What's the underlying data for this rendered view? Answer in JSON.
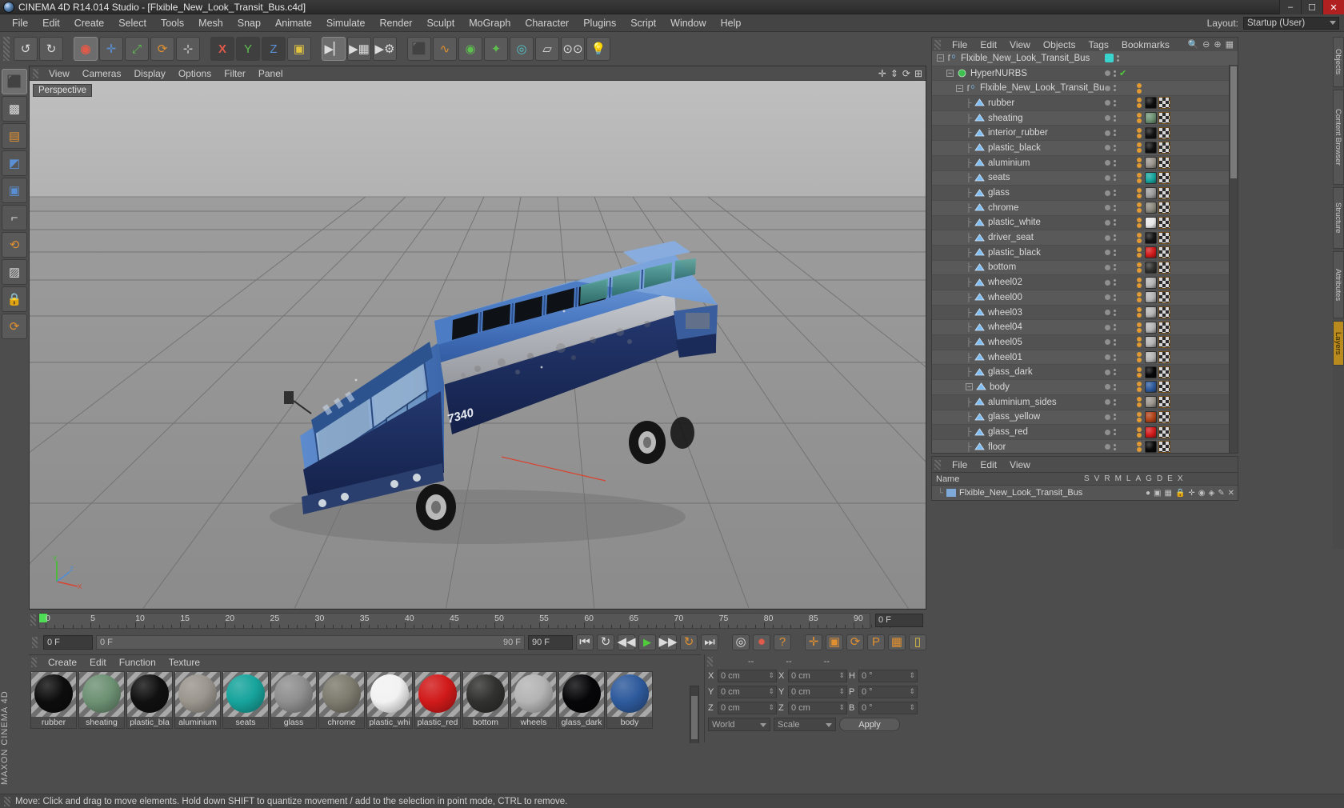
{
  "window": {
    "title": "CINEMA 4D R14.014 Studio - [Flxible_New_Look_Transit_Bus.c4d]",
    "minimize": "–",
    "maximize": "☐",
    "close": "✕"
  },
  "menubar": {
    "items": [
      "File",
      "Edit",
      "Create",
      "Select",
      "Tools",
      "Mesh",
      "Snap",
      "Animate",
      "Simulate",
      "Render",
      "Sculpt",
      "MoGraph",
      "Character",
      "Plugins",
      "Script",
      "Window",
      "Help"
    ],
    "layout_label": "Layout:",
    "layout_value": "Startup (User)"
  },
  "viewport": {
    "menu": [
      "View",
      "Cameras",
      "Display",
      "Options",
      "Filter",
      "Panel"
    ],
    "label": "Perspective",
    "axis": {
      "x": "X",
      "y": "Y",
      "z": "Z"
    }
  },
  "timeline": {
    "ticks": [
      "0",
      "5",
      "10",
      "15",
      "20",
      "25",
      "30",
      "35",
      "40",
      "45",
      "50",
      "55",
      "60",
      "65",
      "70",
      "75",
      "80",
      "85",
      "90"
    ],
    "current_frame": "0 F"
  },
  "playback": {
    "frame_field": "0 F",
    "range_start": "0 F",
    "range_end_left": "90 F",
    "range_end_right": "90 F"
  },
  "material_manager": {
    "menu": [
      "Create",
      "Edit",
      "Function",
      "Texture"
    ],
    "materials": [
      {
        "name": "rubber",
        "color": "#0d0d0d"
      },
      {
        "name": "sheating",
        "color": "#6d9173"
      },
      {
        "name": "plastic_bla",
        "color": "#101010"
      },
      {
        "name": "aluminium",
        "color": "#9a958d"
      },
      {
        "name": "seats",
        "color": "#17a49c"
      },
      {
        "name": "glass",
        "color": "#8f8f8f"
      },
      {
        "name": "chrome",
        "color": "#7d7a6e"
      },
      {
        "name": "plastic_whi",
        "color": "#f2f2f2"
      },
      {
        "name": "plastic_red",
        "color": "#d11a1a"
      },
      {
        "name": "bottom",
        "color": "#31312f"
      },
      {
        "name": "wheels",
        "color": "#b4b4b4"
      },
      {
        "name": "glass_dark",
        "color": "#060608"
      },
      {
        "name": "body",
        "color": "#2e5a9c"
      }
    ]
  },
  "coordinates": {
    "headers": [
      "--",
      "--",
      "--"
    ],
    "rows": [
      {
        "l1": "X",
        "v1": "0 cm",
        "l2": "X",
        "v2": "0 cm",
        "l3": "H",
        "v3": "0 °"
      },
      {
        "l1": "Y",
        "v1": "0 cm",
        "l2": "Y",
        "v2": "0 cm",
        "l3": "P",
        "v3": "0 °"
      },
      {
        "l1": "Z",
        "v1": "0 cm",
        "l2": "Z",
        "v2": "0 cm",
        "l3": "B",
        "v3": "0 °"
      }
    ],
    "world_select": "World",
    "scale_select": "Scale",
    "apply_button": "Apply"
  },
  "object_manager": {
    "menu": [
      "File",
      "Edit",
      "View",
      "Objects",
      "Tags",
      "Bookmarks"
    ],
    "items": [
      {
        "name": "Flxible_New_Look_Transit_Bus",
        "indent": 0,
        "icon": "null-object",
        "expander": true,
        "teal": true,
        "check": false,
        "tags": []
      },
      {
        "name": "HyperNURBS",
        "indent": 1,
        "icon": "hypernurbs",
        "expander": true,
        "teal": false,
        "check": true,
        "tags": []
      },
      {
        "name": "Flxible_New_Look_Transit_Bus",
        "indent": 2,
        "icon": "null-object",
        "expander": true,
        "teal": false,
        "check": false,
        "tags": [
          "dots"
        ]
      },
      {
        "name": "rubber",
        "indent": 3,
        "icon": "polygon",
        "expander": false,
        "teal": false,
        "check": false,
        "tags": [
          "dots",
          "#0d0d0d",
          "checker"
        ]
      },
      {
        "name": "sheating",
        "indent": 3,
        "icon": "polygon",
        "expander": false,
        "teal": false,
        "check": false,
        "tags": [
          "dots",
          "#6d9173",
          "checker"
        ]
      },
      {
        "name": "interior_rubber",
        "indent": 3,
        "icon": "polygon",
        "expander": false,
        "teal": false,
        "check": false,
        "tags": [
          "dots",
          "#121212",
          "checker"
        ]
      },
      {
        "name": "plastic_black",
        "indent": 3,
        "icon": "polygon",
        "expander": false,
        "teal": false,
        "check": false,
        "tags": [
          "dots",
          "#101010",
          "checker"
        ]
      },
      {
        "name": "aluminium",
        "indent": 3,
        "icon": "polygon",
        "expander": false,
        "teal": false,
        "check": false,
        "tags": [
          "dots",
          "#9a958d",
          "checker"
        ]
      },
      {
        "name": "seats",
        "indent": 3,
        "icon": "polygon",
        "expander": false,
        "teal": false,
        "check": false,
        "tags": [
          "dots",
          "#17a49c",
          "checker"
        ]
      },
      {
        "name": "glass",
        "indent": 3,
        "icon": "polygon",
        "expander": false,
        "teal": false,
        "check": false,
        "tags": [
          "dots",
          "#9b9b9b",
          "checker"
        ]
      },
      {
        "name": "chrome",
        "indent": 3,
        "icon": "polygon",
        "expander": false,
        "teal": false,
        "check": false,
        "tags": [
          "dots",
          "#8c8a7e",
          "checker"
        ]
      },
      {
        "name": "plastic_white",
        "indent": 3,
        "icon": "polygon",
        "expander": false,
        "teal": false,
        "check": false,
        "tags": [
          "dots",
          "#e8e8e8",
          "checker"
        ]
      },
      {
        "name": "driver_seat",
        "indent": 3,
        "icon": "polygon",
        "expander": false,
        "teal": false,
        "check": false,
        "tags": [
          "dots",
          "#151515",
          "checker"
        ]
      },
      {
        "name": "plastic_black",
        "indent": 3,
        "icon": "polygon",
        "expander": false,
        "teal": false,
        "check": false,
        "tags": [
          "dots",
          "#d11a1a",
          "checker"
        ]
      },
      {
        "name": "bottom",
        "indent": 3,
        "icon": "polygon",
        "expander": false,
        "teal": false,
        "check": false,
        "tags": [
          "dots",
          "#31312f",
          "checker"
        ]
      },
      {
        "name": "wheel02",
        "indent": 3,
        "icon": "polygon",
        "expander": false,
        "teal": false,
        "check": false,
        "tags": [
          "dots",
          "#b4b4b4",
          "checker"
        ]
      },
      {
        "name": "wheel00",
        "indent": 3,
        "icon": "polygon",
        "expander": false,
        "teal": false,
        "check": false,
        "tags": [
          "dots",
          "#b4b4b4",
          "checker"
        ]
      },
      {
        "name": "wheel03",
        "indent": 3,
        "icon": "polygon",
        "expander": false,
        "teal": false,
        "check": false,
        "tags": [
          "dots",
          "#b4b4b4",
          "checker"
        ]
      },
      {
        "name": "wheel04",
        "indent": 3,
        "icon": "polygon",
        "expander": false,
        "teal": false,
        "check": false,
        "tags": [
          "dots",
          "#b4b4b4",
          "checker"
        ]
      },
      {
        "name": "wheel05",
        "indent": 3,
        "icon": "polygon",
        "expander": false,
        "teal": false,
        "check": false,
        "tags": [
          "dots",
          "#b4b4b4",
          "checker"
        ]
      },
      {
        "name": "wheel01",
        "indent": 3,
        "icon": "polygon",
        "expander": false,
        "teal": false,
        "check": false,
        "tags": [
          "dots",
          "#b4b4b4",
          "checker"
        ]
      },
      {
        "name": "glass_dark",
        "indent": 3,
        "icon": "polygon",
        "expander": false,
        "teal": false,
        "check": false,
        "tags": [
          "dots",
          "#060608",
          "checker"
        ]
      },
      {
        "name": "body",
        "indent": 3,
        "icon": "polygon",
        "expander": true,
        "teal": false,
        "check": false,
        "tags": [
          "dots",
          "#2e5a9c",
          "checker"
        ]
      },
      {
        "name": "aluminium_sides",
        "indent": 3,
        "icon": "polygon",
        "expander": false,
        "teal": false,
        "check": false,
        "tags": [
          "dots",
          "#9a958d",
          "checker"
        ]
      },
      {
        "name": "glass_yellow",
        "indent": 3,
        "icon": "polygon",
        "expander": false,
        "teal": false,
        "check": false,
        "tags": [
          "dots",
          "#b0431a",
          "checker"
        ]
      },
      {
        "name": "glass_red",
        "indent": 3,
        "icon": "polygon",
        "expander": false,
        "teal": false,
        "check": false,
        "tags": [
          "dots",
          "#d11a1a",
          "checker"
        ]
      },
      {
        "name": "floor",
        "indent": 3,
        "icon": "polygon",
        "expander": false,
        "teal": false,
        "check": false,
        "tags": [
          "dots",
          "#0a0a0a",
          "checker"
        ]
      }
    ]
  },
  "attributes": {
    "menu": [
      "File",
      "Edit",
      "View"
    ]
  },
  "layer_manager": {
    "name_header": "Name",
    "columns": [
      "S",
      "V",
      "R",
      "M",
      "L",
      "A",
      "G",
      "D",
      "E",
      "X"
    ],
    "row_name": "Flxible_New_Look_Transit_Bus"
  },
  "right_tabs": [
    "Objects",
    "Content Browser",
    "Structure",
    "Attributes",
    "Layers"
  ],
  "brand": "MAXON CINEMA 4D",
  "statusbar": {
    "text": "Move: Click and drag to move elements. Hold down SHIFT to quantize movement / add to the selection in point mode, CTRL to remove."
  },
  "toolbar": {
    "buttons": [
      "undo",
      "redo",
      "live-selection",
      "move",
      "scale",
      "rotate",
      "frame",
      "x-axis",
      "y-axis",
      "z-axis",
      "world-coordinates",
      "render-view",
      "render-region",
      "render-settings",
      "cube",
      "spline",
      "nurbs",
      "array",
      "deformer",
      "scene",
      "camera",
      "light"
    ]
  },
  "left_tools": [
    "model-mode",
    "texture-mode",
    "points-mode",
    "edges-mode",
    "polygons-mode",
    "workplane",
    "axis-lock",
    "enable-axis",
    "lock-axis",
    "snap"
  ],
  "bus": {
    "fleet_number": "7340",
    "body_color": "#3a6ab5",
    "skirt_color": "#16255e",
    "roof_color": "#5f8fd4",
    "glass_color": "#3e8f8c"
  }
}
